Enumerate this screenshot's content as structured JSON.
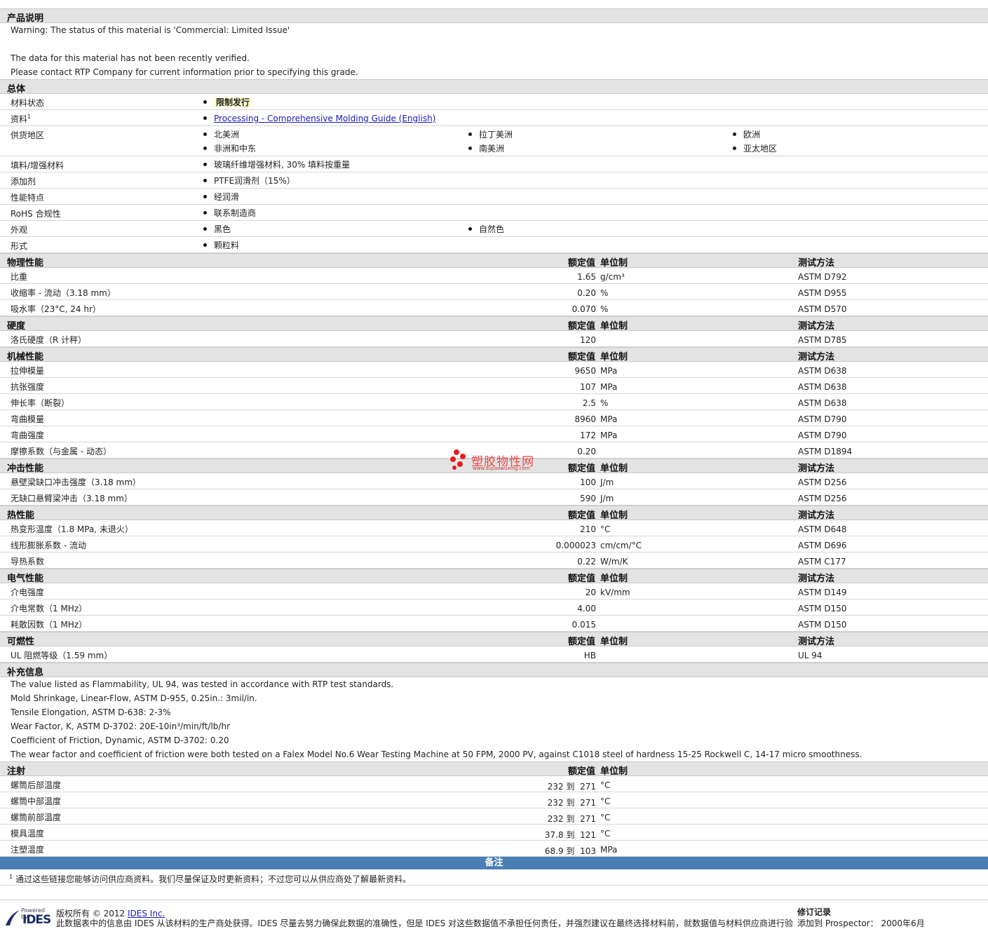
{
  "description_section": {
    "title": "产品说明",
    "lines": [
      "Warning: The status of this material is 'Commercial: Limited Issue'",
      "",
      "The data for this material has not been recently verified.",
      "Please contact RTP Company for current information prior to specifying this grade."
    ]
  },
  "general": {
    "title": "总体",
    "rows": [
      {
        "label": "材料状态",
        "items": [
          "限制发行"
        ],
        "highlight": true
      },
      {
        "label": "资料",
        "sup": "1",
        "items": [
          "Processing - Comprehensive Molding Guide (English)"
        ],
        "link": true
      },
      {
        "label": "供货地区",
        "items": [
          "北美洲",
          "拉丁美洲",
          "欧洲",
          "非洲和中东",
          "南美洲",
          "亚太地区"
        ]
      },
      {
        "label": "填料/增强材料",
        "items": [
          "玻璃纤维增强材料, 30% 填料按重量"
        ]
      },
      {
        "label": "添加剂",
        "items": [
          "PTFE润滑剂（15%）"
        ]
      },
      {
        "label": "性能特点",
        "items": [
          "经润滑"
        ]
      },
      {
        "label": "RoHS 合规性",
        "items": [
          "联系制造商"
        ]
      },
      {
        "label": "外观",
        "items": [
          "黑色",
          "自然色"
        ]
      },
      {
        "label": "形式",
        "items": [
          "颗粒料"
        ]
      }
    ]
  },
  "column_headers": {
    "nominal": "额定值",
    "unit": "单位制",
    "test": "测试方法"
  },
  "property_sections": [
    {
      "title": "物理性能",
      "rows": [
        {
          "label": "比重",
          "value": "1.65",
          "unit": "g/cm³",
          "test": "ASTM D792"
        },
        {
          "label": "收缩率 - 流动（3.18 mm）",
          "value": "0.20",
          "unit": "%",
          "test": "ASTM D955"
        },
        {
          "label": "吸水率（23°C, 24 hr）",
          "value": "0.070",
          "unit": "%",
          "test": "ASTM D570"
        }
      ]
    },
    {
      "title": "硬度",
      "rows": [
        {
          "label": "洛氏硬度（R 计秤）",
          "value": "120",
          "unit": "",
          "test": "ASTM D785"
        }
      ]
    },
    {
      "title": "机械性能",
      "rows": [
        {
          "label": "拉伸模量",
          "value": "9650",
          "unit": "MPa",
          "test": "ASTM D638"
        },
        {
          "label": "抗张强度",
          "value": "107",
          "unit": "MPa",
          "test": "ASTM D638"
        },
        {
          "label": "伸长率（断裂）",
          "value": "2.5",
          "unit": "%",
          "test": "ASTM D638"
        },
        {
          "label": "弯曲模量",
          "value": "8960",
          "unit": "MPa",
          "test": "ASTM D790"
        },
        {
          "label": "弯曲强度",
          "value": "172",
          "unit": "MPa",
          "test": "ASTM D790"
        },
        {
          "label": "摩擦系数（与金属 - 动态）",
          "value": "0.20",
          "unit": "",
          "test": "ASTM D1894"
        }
      ]
    },
    {
      "title": "冲击性能",
      "rows": [
        {
          "label": "悬壁梁缺口冲击强度（3.18 mm）",
          "value": "100",
          "unit": "J/m",
          "test": "ASTM D256"
        },
        {
          "label": "无缺口悬臂梁冲击（3.18 mm）",
          "value": "590",
          "unit": "J/m",
          "test": "ASTM D256"
        }
      ]
    },
    {
      "title": "热性能",
      "rows": [
        {
          "label": "热变形温度（1.8 MPa, 未退火）",
          "value": "210",
          "unit": "°C",
          "test": "ASTM D648"
        },
        {
          "label": "线形膨胀系数 - 流动",
          "value": "0.000023",
          "unit": "cm/cm/°C",
          "test": "ASTM D696"
        },
        {
          "label": "导热系数",
          "value": "0.22",
          "unit": "W/m/K",
          "test": "ASTM C177"
        }
      ]
    },
    {
      "title": "电气性能",
      "rows": [
        {
          "label": "介电强度",
          "value": "20",
          "unit": "kV/mm",
          "test": "ASTM D149"
        },
        {
          "label": "介电常数（1 MHz）",
          "value": "4.00",
          "unit": "",
          "test": "ASTM D150"
        },
        {
          "label": "耗散因数（1 MHz）",
          "value": "0.015",
          "unit": "",
          "test": "ASTM D150"
        }
      ]
    },
    {
      "title": "可燃性",
      "rows": [
        {
          "label": "UL 阻燃等级（1.59 mm）",
          "value": "HB",
          "unit": "",
          "test": "UL 94"
        }
      ]
    }
  ],
  "supplemental": {
    "title": "补充信息",
    "lines": [
      "The value listed as Flammability, UL 94, was tested in accordance with RTP test standards.",
      "Mold Shrinkage, Linear-Flow, ASTM D-955, 0.25in.: 3mil/in.",
      "Tensile Elongation, ASTM D-638: 2-3%",
      "Wear Factor, K, ASTM D-3702: 20E-10in³/min/ft/lb/hr",
      "Coefficient of Friction, Dynamic, ASTM D-3702: 0.20",
      "The wear factor and coefficient of friction were both tested on a Falex Model No.6 Wear Testing Machine at 50 FPM, 2000 PV, against C1018 steel of hardness 15-25 Rockwell C, 14-17 micro smoothness."
    ]
  },
  "injection": {
    "title": "注射",
    "rows": [
      {
        "label": "螺筒后部温度",
        "value": "232 到  271",
        "unit": "°C"
      },
      {
        "label": "螺筒中部温度",
        "value": "232 到  271",
        "unit": "°C"
      },
      {
        "label": "螺筒前部温度",
        "value": "232 到  271",
        "unit": "°C"
      },
      {
        "label": "模具温度",
        "value": "37.8 到  121",
        "unit": "°C"
      },
      {
        "label": "注塑温度",
        "value": "68.9 到  103",
        "unit": "MPa"
      }
    ]
  },
  "notes": {
    "title": "备注",
    "footnote_sup": "1",
    "footnote": "通过这些链接您能够访问供应商资料。我们尽量保证及时更新资料；不过您可以从供应商处了解最新资料。"
  },
  "watermark": {
    "text": "塑胶物性网",
    "url": "www.sujiaowuxing.com"
  },
  "footer": {
    "logo_powered": "Powered by",
    "logo_brand": "IDES",
    "copyright_prefix": "版权所有 © 2012",
    "copyright_link": "IDES Inc.",
    "disclaimer": "此数据表中的信息由 IDES 从该材料的生产商处获得。IDES 尽量去努力确保此数据的准确性，但是 IDES 对这些数据值不承担任何责任，并强烈建议在最终选择材料前，就数据值与材料供应商进行验",
    "revision_title": "修订记录",
    "revision_text": "添加到 Prospector： 2000年6月"
  }
}
